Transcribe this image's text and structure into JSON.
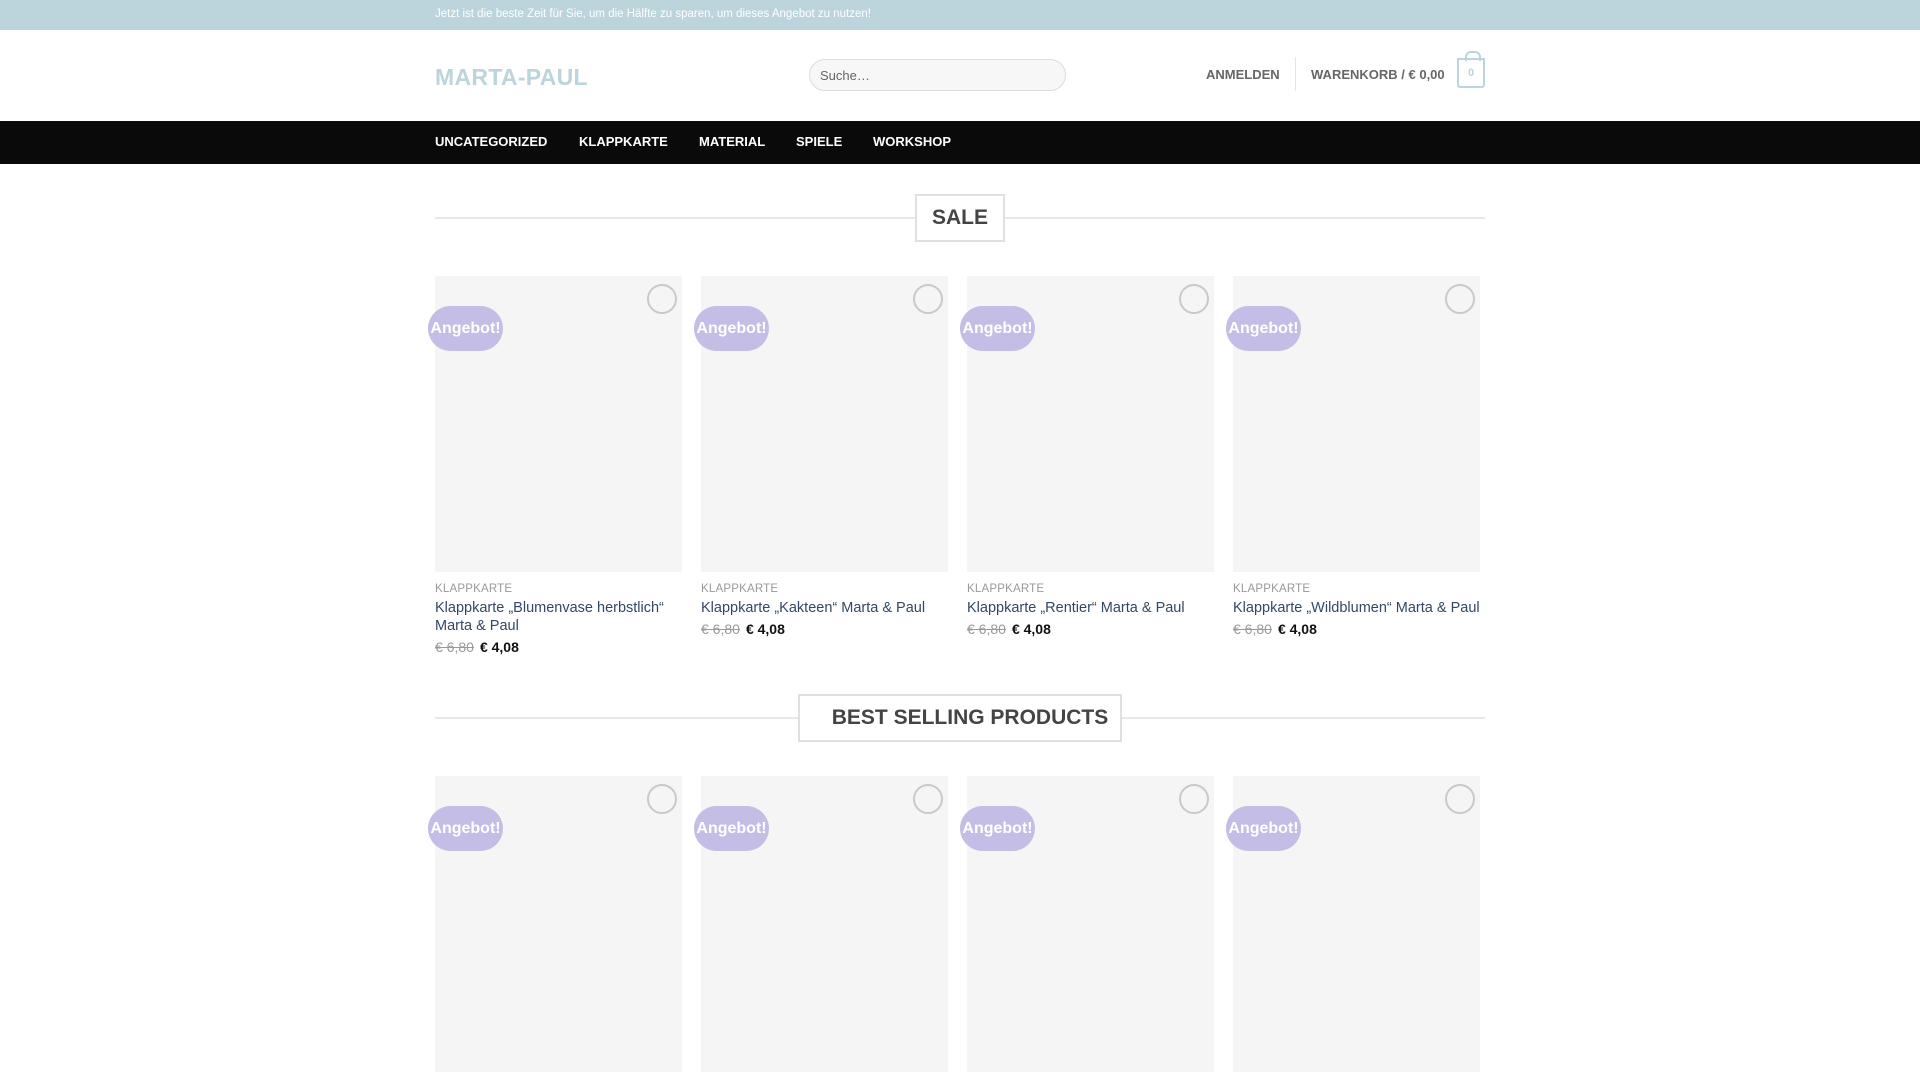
{
  "topbar": {
    "text": "Jetzt ist die beste Zeit für Sie, um die Hälfte zu sparen, um dieses Angebot zu nutzen!"
  },
  "header": {
    "logo": "MARTA-PAUL",
    "search_placeholder": "Suche…",
    "login_label": "ANMELDEN",
    "cart_label": "WARENKORB / € 0,00",
    "cart_count": "0"
  },
  "nav": {
    "items": [
      "UNCATEGORIZED",
      "KLAPPKARTE",
      "MATERIAL",
      "SPIELE",
      "WORKSHOP"
    ]
  },
  "sections": [
    {
      "title": "SALE",
      "products": [
        {
          "badge": "Angebot!",
          "category": "KLAPPKARTE",
          "title": "Klappkarte „Blumenvase herbstlich“ Marta & Paul",
          "old_price": "€ 6,80",
          "new_price": "€ 4,08"
        },
        {
          "badge": "Angebot!",
          "category": "KLAPPKARTE",
          "title": "Klappkarte „Kakteen“ Marta & Paul",
          "old_price": "€ 6,80",
          "new_price": "€ 4,08"
        },
        {
          "badge": "Angebot!",
          "category": "KLAPPKARTE",
          "title": "Klappkarte „Rentier“ Marta & Paul",
          "old_price": "€ 6,80",
          "new_price": "€ 4,08"
        },
        {
          "badge": "Angebot!",
          "category": "KLAPPKARTE",
          "title": "Klappkarte „Wildblumen“ Marta & Paul",
          "old_price": "€ 6,80",
          "new_price": "€ 4,08"
        }
      ]
    },
    {
      "title": "BEST SELLING PRODUCTS",
      "products": [
        {
          "badge": "Angebot!"
        },
        {
          "badge": "Angebot!"
        },
        {
          "badge": "Angebot!"
        },
        {
          "badge": "Angebot!"
        }
      ]
    }
  ],
  "colors": {
    "accent": "#bcd4db",
    "badge": "#c4bde6",
    "nav_bg": "#0a0a0a",
    "link": "#334862"
  },
  "icons": {
    "wishlist": "heart-outline-icon",
    "cart": "cart-bag-icon"
  }
}
